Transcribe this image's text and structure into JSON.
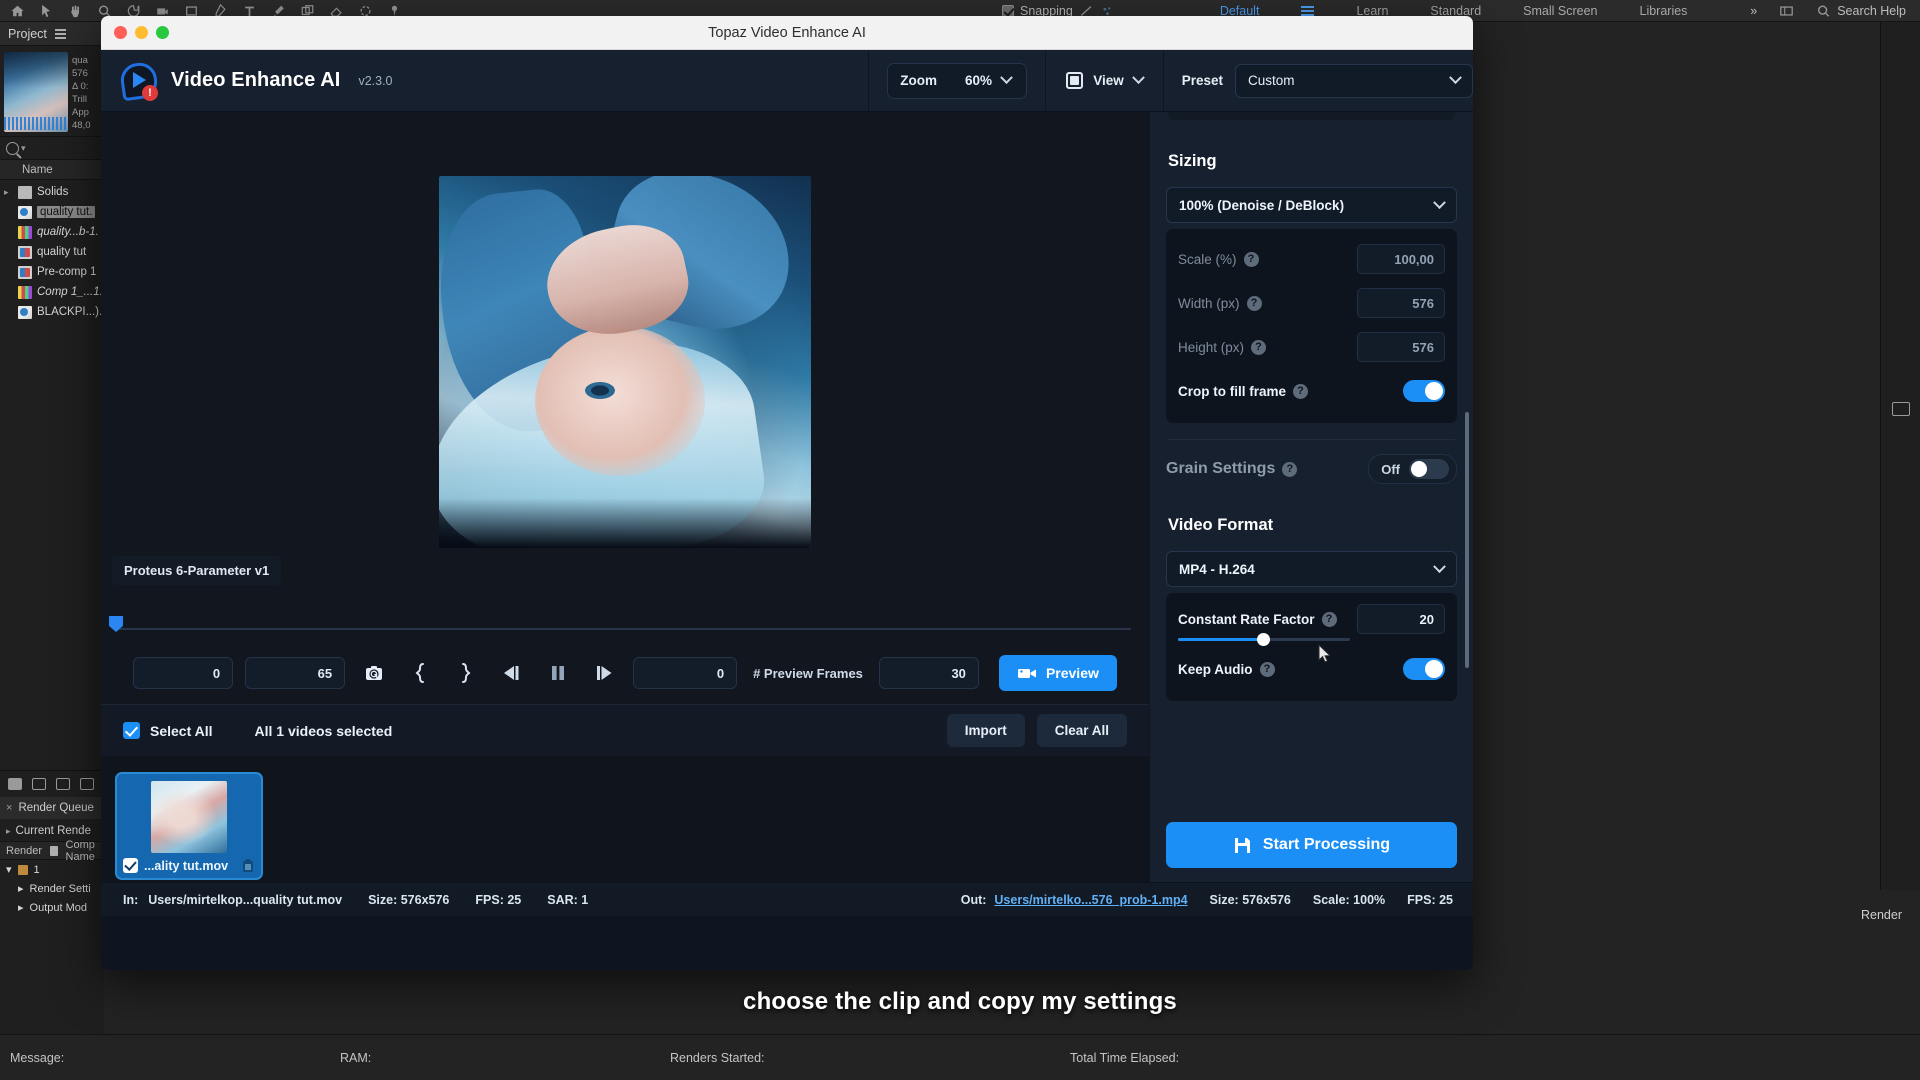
{
  "host_app": {
    "menubar": {
      "snapping_label": "Snapping",
      "workspaces": [
        "Default",
        "Learn",
        "Standard",
        "Small Screen",
        "Libraries"
      ],
      "active_workspace": "Default",
      "overflow": "»",
      "search_label": "Search Help"
    },
    "project_panel": {
      "tab_label": "Project",
      "meta_lines": [
        "qua",
        "576",
        "Δ 0:",
        "Trill",
        "App",
        "48,0"
      ],
      "column_header": "Name",
      "items": [
        {
          "label": "Solids",
          "icon": "folder-icon",
          "italic": false,
          "selected": false,
          "disclosure": true
        },
        {
          "label": "quality tut.",
          "icon": "still-icon",
          "italic": false,
          "selected": true,
          "disclosure": false
        },
        {
          "label": "quality...b-1.",
          "icon": "bars-icon",
          "italic": true,
          "selected": false,
          "disclosure": false
        },
        {
          "label": "quality tut",
          "icon": "comp-icon",
          "italic": false,
          "selected": false,
          "disclosure": false
        },
        {
          "label": "Pre-comp 1",
          "icon": "comp-icon",
          "italic": false,
          "selected": false,
          "disclosure": false
        },
        {
          "label": "Comp 1_...1.",
          "icon": "bars-icon",
          "italic": true,
          "selected": false,
          "disclosure": false
        },
        {
          "label": "BLACKPI...).",
          "icon": "still-icon",
          "italic": false,
          "selected": false,
          "disclosure": false
        }
      ]
    },
    "render_queue": {
      "tab_label": "Render Queue",
      "current_render_label": "Current Rende",
      "columns": [
        "Render",
        "Comp Name"
      ],
      "row_index": "1",
      "sub_rows": [
        "Render Setti",
        "Output Mod"
      ],
      "render_button": "Render"
    },
    "statusbar": {
      "message_label": "Message:",
      "ram_label": "RAM:",
      "renders_started_label": "Renders Started:",
      "total_time_label": "Total Time Elapsed:"
    }
  },
  "topaz": {
    "window_title": "Topaz Video Enhance AI",
    "app_name": "Video Enhance AI",
    "version": "v2.3.0",
    "logo_badge": "!",
    "toolbar": {
      "zoom_label": "Zoom",
      "zoom_value": "60%",
      "view_label": "View",
      "preset_label": "Preset",
      "preset_value": "Custom"
    },
    "preview": {
      "model_label": "Proteus 6-Parameter v1"
    },
    "transport": {
      "start_frame": "0",
      "end_frame": "65",
      "current_frame": "0",
      "preview_frames_label": "# Preview Frames",
      "preview_frames_value": "30",
      "preview_button": "Preview",
      "icons": [
        "reset-icon",
        "set-in-point-icon",
        "set-out-point-icon",
        "step-back-icon",
        "pause-icon",
        "step-forward-icon"
      ]
    },
    "selection_bar": {
      "select_all_label": "Select All",
      "selection_count": "All 1 videos selected",
      "import_button": "Import",
      "clear_all_button": "Clear All"
    },
    "file_card": {
      "filename": "...ality tut.mov"
    },
    "settings": {
      "sizing": {
        "title": "Sizing",
        "mode": "100% (Denoise / DeBlock)",
        "fields": [
          {
            "label": "Scale (%)",
            "value": "100,00",
            "enabled": false
          },
          {
            "label": "Width (px)",
            "value": "576",
            "enabled": false
          },
          {
            "label": "Height (px)",
            "value": "576",
            "enabled": false
          }
        ],
        "crop_label": "Crop to fill frame",
        "crop_on": true
      },
      "grain": {
        "label": "Grain Settings",
        "state_label": "Off",
        "on": false
      },
      "video_format": {
        "title": "Video Format",
        "codec": "MP4  - H.264",
        "crf_label": "Constant Rate Factor",
        "crf_value": "20",
        "keep_audio_label": "Keep Audio",
        "keep_audio_on": true
      },
      "start_button": "Start Processing"
    },
    "footer": {
      "in_label": "In:",
      "in_path": "Users/mirtelkop...quality tut.mov",
      "in_size": "Size: 576x576",
      "in_fps": "FPS: 25",
      "in_sar": "SAR: 1",
      "out_label": "Out:",
      "out_path": "Users/mirtelko...576_prob-1.mp4",
      "out_size": "Size: 576x576",
      "out_scale": "Scale: 100%",
      "out_fps": "FPS: 25"
    }
  },
  "caption": "choose the clip and copy my settings",
  "colors": {
    "accent_blue": "#1b8ff5",
    "panel_bg": "#17202e",
    "canvas_bg": "#12161e",
    "titlebar_bg": "#f2f2f2",
    "light_red": "#ff5f57",
    "light_yellow": "#febc2e",
    "light_green": "#28c840"
  }
}
